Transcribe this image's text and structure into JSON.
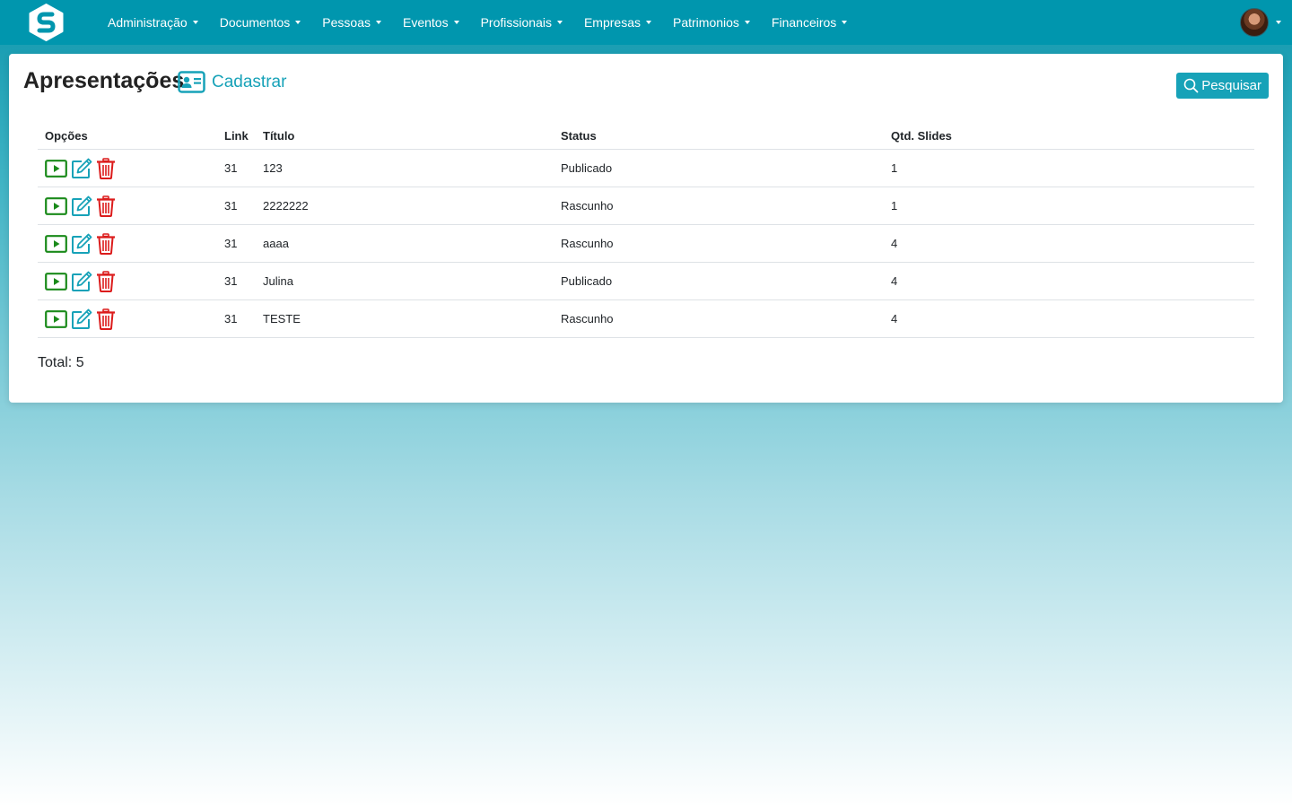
{
  "nav": {
    "items": [
      {
        "label": "Administração"
      },
      {
        "label": "Documentos"
      },
      {
        "label": "Pessoas"
      },
      {
        "label": "Eventos"
      },
      {
        "label": "Profissionais"
      },
      {
        "label": "Empresas"
      },
      {
        "label": "Patrimonios"
      },
      {
        "label": "Financeiros"
      }
    ]
  },
  "page": {
    "title": "Apresentações",
    "create_label": "Cadastrar",
    "search_label": "Pesquisar"
  },
  "table": {
    "headers": {
      "options": "Opções",
      "link": "Link",
      "title": "Título",
      "status": "Status",
      "slides": "Qtd. Slides"
    },
    "rows": [
      {
        "link": "31",
        "title": "123",
        "status": "Publicado",
        "slides": "1"
      },
      {
        "link": "31",
        "title": "2222222",
        "status": "Rascunho",
        "slides": "1"
      },
      {
        "link": "31",
        "title": "aaaa",
        "status": "Rascunho",
        "slides": "4"
      },
      {
        "link": "31",
        "title": "Julina",
        "status": "Publicado",
        "slides": "4"
      },
      {
        "link": "31",
        "title": "TESTE",
        "status": "Rascunho",
        "slides": "4"
      }
    ]
  },
  "footer": {
    "total": "Total: 5"
  },
  "colors": {
    "navbar": "#0096ae",
    "accent": "#17a2b8",
    "play": "#1a8a1a",
    "edit": "#17a2b8",
    "delete": "#dc1c1c"
  },
  "icons": {
    "logo": "logo-s-icon",
    "create": "id-card-icon",
    "search": "search-icon",
    "play": "play-icon",
    "edit": "edit-icon",
    "delete": "trash-icon"
  }
}
